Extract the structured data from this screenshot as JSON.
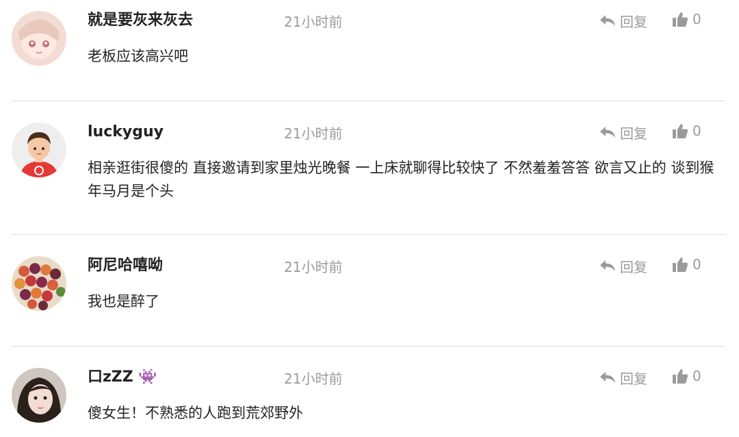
{
  "comments": [
    {
      "username": "就是要灰来灰去",
      "time": "21小时前",
      "reply_label": "回复",
      "like_count": "0",
      "text": "老板应该高兴吧"
    },
    {
      "username": "luckyguy",
      "time": "21小时前",
      "reply_label": "回复",
      "like_count": "0",
      "text": "相亲逛街很傻的 直接邀请到家里烛光晚餐 一上床就聊得比较快了 不然羞羞答答 欲言又止的 谈到猴年马月是个头"
    },
    {
      "username": "阿尼哈嘻呦",
      "time": "21小时前",
      "reply_label": "回复",
      "like_count": "0",
      "text": "我也是醉了"
    },
    {
      "username": "口zZZ 👾",
      "time": "21小时前",
      "reply_label": "回复",
      "like_count": "0",
      "text": "傻女生！不熟悉的人跑到荒郊野外"
    }
  ],
  "colors": {
    "text": "#222222",
    "muted": "#9a9a9a",
    "divider": "#dcdcdc"
  },
  "icons": {
    "reply": "reply-arrow-icon",
    "like": "thumbs-up-icon"
  }
}
